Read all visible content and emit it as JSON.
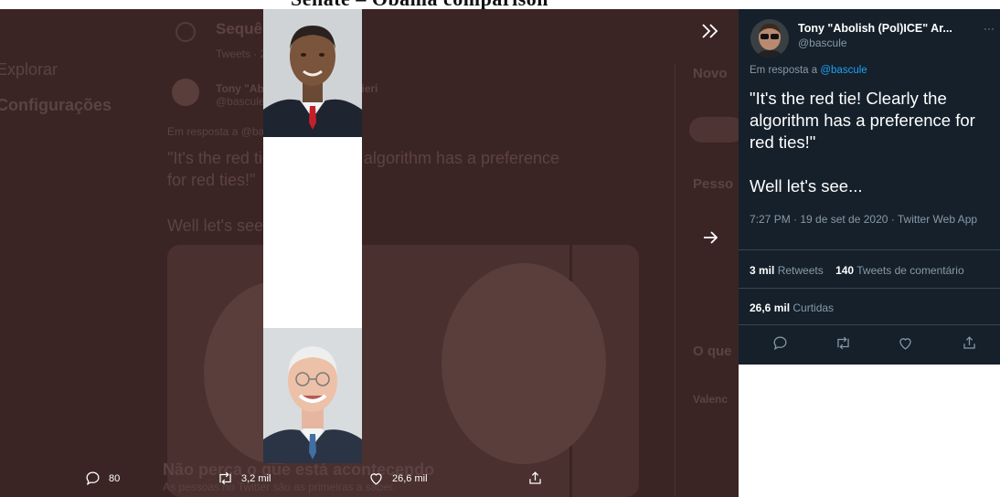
{
  "caption": "Senate – Obama comparison",
  "backdrop": {
    "nav_left": "Explorar",
    "nav_settings": "Configurações",
    "header_title": "Sequência",
    "header_sub": "Tweets · 2 mil",
    "author_name": "Tony \"Abolish (Pol)ICE\" Arcieri",
    "author_handle": "@bascule",
    "in_reply": "Em resposta a @bascule",
    "tweet_line1": "\"It's the red tie! Clearly the algorithm has a preference",
    "tweet_line2": "for red ties!\"",
    "tweet_line3": "Well let's see...",
    "right_label1": "Novo",
    "right_label2": "Pesso",
    "right_label3": "O que",
    "right_label4": "Valenc",
    "banner_title": "Não perca o que está acontecendo",
    "banner_sub": "As pessoas no Twitter são as primeiras a saber."
  },
  "nav": {
    "collapse_icon": "double-chevron-right-icon",
    "next_icon": "arrow-right-icon"
  },
  "bottom_actions": {
    "replies": "80",
    "retweets": "3,2 mil",
    "likes": "26,6 mil"
  },
  "tweet": {
    "author_name": "Tony \"Abolish (Pol)ICE\" Ar...",
    "author_handle": "@bascule",
    "more": "···",
    "reply_prefix": "Em resposta a",
    "reply_mention": "@bascule",
    "text_p1": "\"It's the red tie! Clearly the algorithm has a preference for red ties!\"",
    "text_p2": "Well let's see...",
    "meta": "7:27 PM · 19 de set de 2020 · Twitter Web App",
    "retweets_count": "3 mil",
    "retweets_label": "Retweets",
    "comments_count": "140",
    "comments_label": "Tweets de comentário",
    "likes_count": "26,6 mil",
    "likes_label": "Curtidas"
  },
  "colors": {
    "card_bg": "#15202b",
    "link": "#1da1f2",
    "muted": "#8899a6",
    "backdrop": "#3b2524"
  }
}
